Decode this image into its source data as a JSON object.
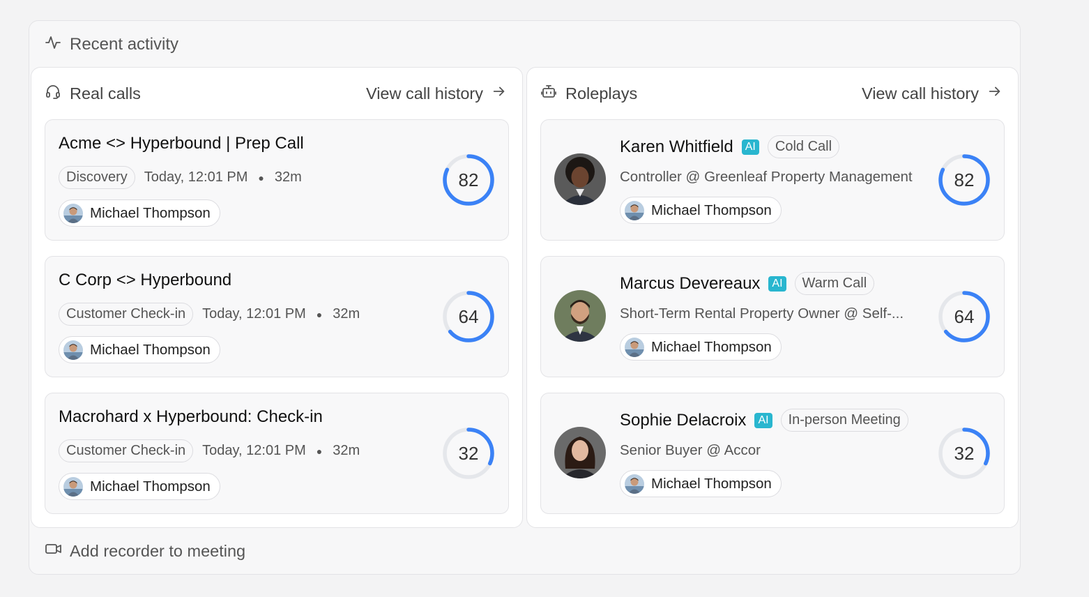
{
  "recent_activity": {
    "title": "Recent activity",
    "footer_label": "Add recorder to meeting"
  },
  "real_calls": {
    "title": "Real calls",
    "link_label": "View call history",
    "items": [
      {
        "title": "Acme <> Hyperbound | Prep Call",
        "tag": "Discovery",
        "time": "Today, 12:01 PM",
        "duration": "32m",
        "user": "Michael Thompson",
        "score": "82",
        "score_value": 82
      },
      {
        "title": "C Corp <> Hyperbound",
        "tag": "Customer Check-in",
        "time": "Today, 12:01 PM",
        "duration": "32m",
        "user": "Michael Thompson",
        "score": "64",
        "score_value": 64
      },
      {
        "title": "Macrohard x Hyperbound: Check-in",
        "tag": "Customer Check-in",
        "time": "Today, 12:01 PM",
        "duration": "32m",
        "user": "Michael Thompson",
        "score": "32",
        "score_value": 32
      }
    ]
  },
  "roleplays": {
    "title": "Roleplays",
    "link_label": "View call history",
    "items": [
      {
        "name": "Karen Whitfield",
        "ai": "AI",
        "tag": "Cold Call",
        "role": "Controller @ Greenleaf Property Management",
        "user": "Michael Thompson",
        "score": "82",
        "score_value": 82
      },
      {
        "name": "Marcus Devereaux",
        "ai": "AI",
        "tag": "Warm Call",
        "role": "Short-Term Rental Property Owner @ Self-...",
        "user": "Michael Thompson",
        "score": "64",
        "score_value": 64
      },
      {
        "name": "Sophie Delacroix",
        "ai": "AI",
        "tag": "In-person Meeting",
        "role": "Senior Buyer @ Accor",
        "user": "Michael Thompson",
        "score": "32",
        "score_value": 32
      }
    ]
  },
  "colors": {
    "accent": "#3b82f6",
    "ring_track": "#e5e7eb",
    "ai_badge": "#29b6cf"
  },
  "icons": {
    "recent_activity": "activity-pulse-icon",
    "real_calls": "headset-icon",
    "roleplays": "bot-icon",
    "link": "arrow-right-icon",
    "footer": "video-camera-icon"
  }
}
